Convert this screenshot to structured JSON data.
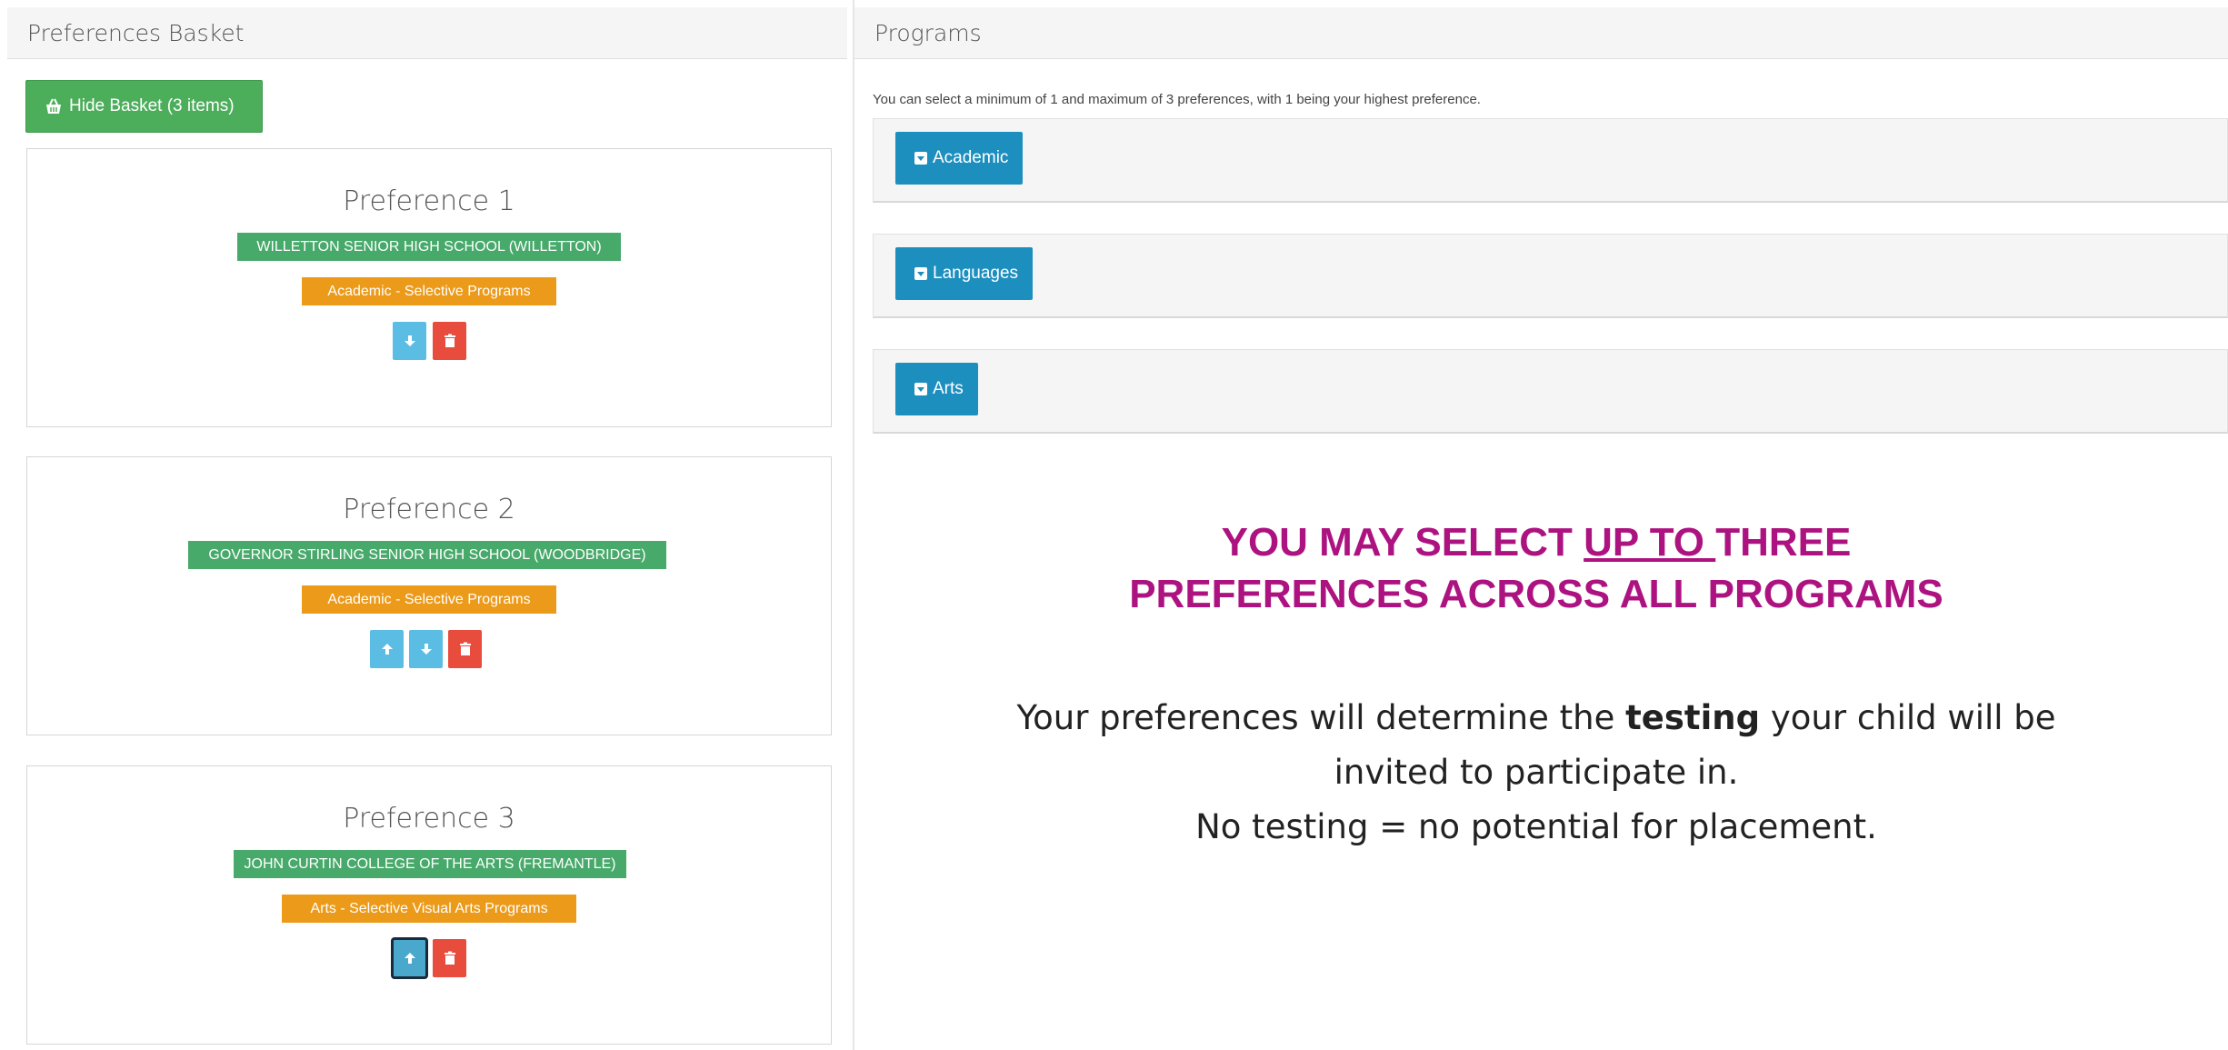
{
  "left": {
    "header": "Preferences Basket",
    "basket_button": "Hide Basket (3 items)",
    "preferences": [
      {
        "title": "Preference 1",
        "school": "WILLETTON SENIOR HIGH SCHOOL (WILLETTON)",
        "program": "Academic - Selective Programs"
      },
      {
        "title": "Preference 2",
        "school": "GOVERNOR STIRLING SENIOR HIGH SCHOOL (WOODBRIDGE)",
        "program": "Academic - Selective Programs"
      },
      {
        "title": "Preference 3",
        "school": "JOHN CURTIN COLLEGE OF THE ARTS (FREMANTLE)",
        "program": "Arts - Selective Visual Arts Programs"
      }
    ]
  },
  "right": {
    "header": "Programs",
    "hint": "You can select a minimum of 1 and maximum of 3 preferences, with 1 being your highest preference.",
    "categories": [
      "Academic",
      "Languages",
      "Arts"
    ],
    "headline": {
      "part1": "YOU MAY SELECT ",
      "underlined": "UP TO ",
      "part2": "THREE",
      "line2": "PREFERENCES ACROSS ALL PROGRAMS"
    },
    "info": {
      "line1_pre": "Your preferences will determine the ",
      "line1_bold": "testing",
      "line1_post": " your child will be",
      "line2": "invited to participate in.",
      "line3": "No testing = no potential for placement."
    }
  },
  "colors": {
    "green_button": "#4cae5b",
    "school_label": "#47a96a",
    "program_label": "#ec9a1a",
    "move_button": "#5bbde3",
    "delete_button": "#e74c3c",
    "category_button": "#1d8fbf",
    "headline": "#ad1380"
  },
  "icons": {
    "basket": "basket-icon",
    "move_down": "arrow-down-icon",
    "move_up": "arrow-up-icon",
    "delete": "trash-icon",
    "expand": "expand-square-icon"
  }
}
